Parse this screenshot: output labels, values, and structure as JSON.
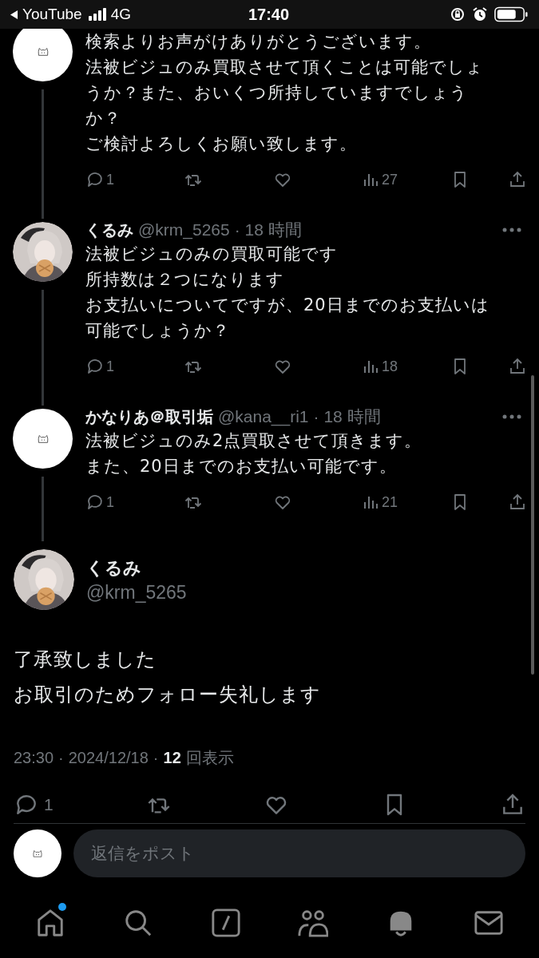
{
  "status_bar": {
    "back_label": "YouTube",
    "network": "4G",
    "time": "17:40"
  },
  "replies": [
    {
      "avatar": {
        "kind": "icon"
      },
      "text": [
        "検索よりお声がけありがとうございます。",
        "法被ビジュのみ買取させて頂くことは可能でしょうか？また、おいくつ所持していますでしょうか？",
        "ご検討よろしくお願い致します。"
      ],
      "reply_count": "1",
      "view_count": "27"
    },
    {
      "author": {
        "name": "くるみ",
        "handle": "@krm_5265",
        "time": "· 18 時間"
      },
      "avatar": {
        "kind": "picture"
      },
      "text": [
        "法被ビジュのみの買取可能です",
        "所持数は２つになります",
        "お支払いについてですが、20日までのお支払いは可能でしょうか？"
      ],
      "reply_count": "1",
      "view_count": "18"
    },
    {
      "author": {
        "name": "かなりあ＠取引垢",
        "handle": "@kana__ri1",
        "time": "· 18 時間"
      },
      "avatar": {
        "kind": "icon"
      },
      "text": [
        "法被ビジュのみ2点買取させて頂きます。",
        "また、20日までのお支払い可能です。"
      ],
      "reply_count": "1",
      "view_count": "21"
    }
  ],
  "main_post": {
    "name": "くるみ",
    "handle": "@krm_5265",
    "avatar": {
      "kind": "picture"
    },
    "text": [
      "了承致しました",
      "お取引のためフォロー失礼します"
    ],
    "time": "23:30",
    "separator_1": "·",
    "date": "2024/12/18",
    "separator_2": "·",
    "view_count": "12",
    "view_label": "回表示",
    "reply_count": "1"
  },
  "reply_box": {
    "placeholder": "返信をポスト"
  },
  "nav": [
    {
      "kind": "home",
      "badge": true
    },
    {
      "kind": "search",
      "badge": false
    },
    {
      "kind": "grok",
      "badge": false
    },
    {
      "kind": "communities",
      "badge": false
    },
    {
      "kind": "notifications",
      "badge": false
    },
    {
      "kind": "messages",
      "badge": false
    }
  ]
}
